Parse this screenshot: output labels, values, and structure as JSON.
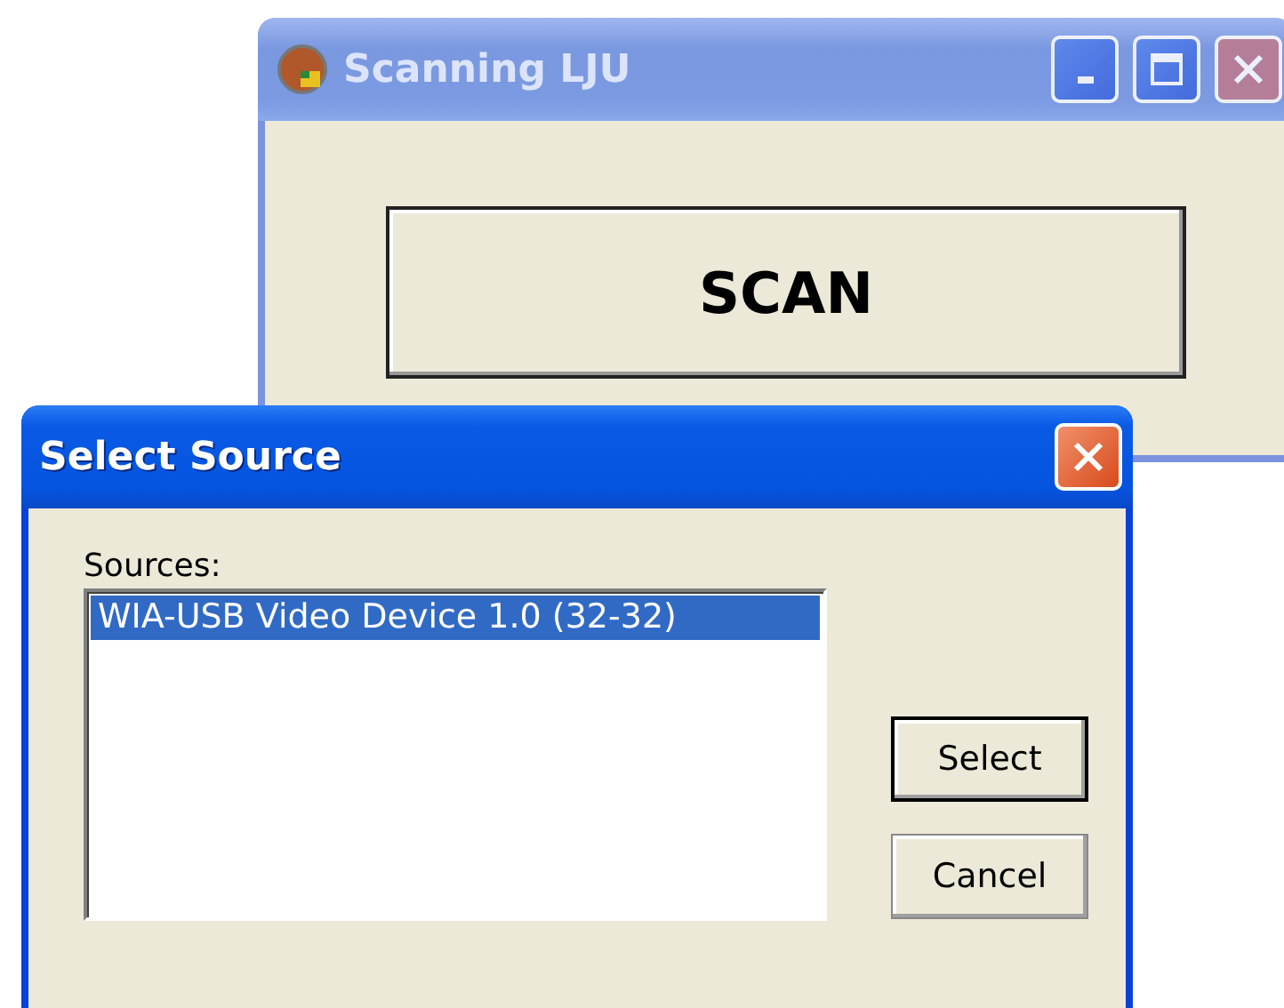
{
  "windows": [
    {
      "title": "Scanning LJU",
      "active": false,
      "app_icon": true,
      "controls": [
        {
          "kind": "minimize"
        },
        {
          "kind": "maximize"
        },
        {
          "kind": "close"
        }
      ],
      "buttons": [
        {
          "label": "SCAN",
          "default": false
        }
      ]
    },
    {
      "title": "Select Source",
      "active": true,
      "app_icon": false,
      "controls": [
        {
          "kind": "close"
        }
      ],
      "list_label": "Sources:",
      "sources": [
        {
          "label": "WIA-USB Video Device 1.0 (32-32)",
          "selected": true
        }
      ],
      "buttons": [
        {
          "label": "Select",
          "default": true
        },
        {
          "label": "Cancel",
          "default": false
        }
      ]
    }
  ]
}
